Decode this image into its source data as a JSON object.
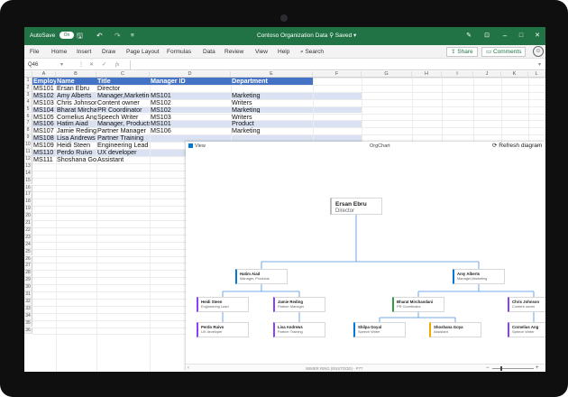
{
  "titlebar": {
    "autosave_label": "AutoSave",
    "autosave_state": "On",
    "doc_title": "Contoso Organization Data",
    "saved_state": "Saved",
    "minimize": "–",
    "restore": "□",
    "close": "✕"
  },
  "menu": {
    "items": [
      "File",
      "Home",
      "Insert",
      "Draw",
      "Page Layout",
      "Formulas",
      "Data",
      "Review",
      "View",
      "Help"
    ],
    "search_label": "Search",
    "share_label": "Share",
    "comments_label": "Comments"
  },
  "formula_bar": {
    "name_box": "Q46",
    "fx_label": "fx",
    "value": ""
  },
  "columns": [
    "A",
    "B",
    "C",
    "D",
    "E",
    "F",
    "G",
    "H",
    "I",
    "J",
    "K",
    "L",
    "M"
  ],
  "rows": [
    "1",
    "2",
    "3",
    "4",
    "5",
    "6",
    "7",
    "8",
    "9",
    "10",
    "11",
    "12",
    "13",
    "14",
    "15",
    "16",
    "17",
    "18",
    "19",
    "20",
    "21",
    "22",
    "23",
    "24",
    "25",
    "26",
    "27",
    "28",
    "29",
    "30",
    "31",
    "32",
    "33",
    "34",
    "35",
    "36"
  ],
  "table": {
    "headers": [
      "Employee ID",
      "Name",
      "Title",
      "Manager ID",
      "Department"
    ],
    "rows": [
      [
        "MS101",
        "Ersan Ebru",
        "Director",
        "",
        ""
      ],
      [
        "MS102",
        "Amy Alberts",
        "Manager,Marketing",
        "MS101",
        "Marketing"
      ],
      [
        "MS103",
        "Chris Johnson",
        "Content owner",
        "MS102",
        "Writers"
      ],
      [
        "MS104",
        "Bharat Mirchandani",
        "PR Coordinator",
        "MS102",
        "Marketing"
      ],
      [
        "MS105",
        "Cornelius Ang",
        "Speech Writer",
        "MS103",
        "Writers"
      ],
      [
        "MS106",
        "Hatim Aiad",
        "Manager, Products",
        "MS101",
        "Product"
      ],
      [
        "MS107",
        "Jamie Reding",
        "Partner Manager",
        "MS106",
        "Marketing"
      ],
      [
        "MS108",
        "Lisa Andrews",
        "Partner Training",
        "",
        ""
      ],
      [
        "MS109",
        "Heidi Steen",
        "Engineering Lead",
        "",
        ""
      ],
      [
        "MS110",
        "Perdo Ruivo",
        "UX developer",
        "",
        ""
      ],
      [
        "MS111",
        "Shoshana Goya",
        "Assistant",
        "",
        ""
      ]
    ]
  },
  "orgpane": {
    "view_label": "View",
    "title": "OrgChart",
    "refresh_label": "Refresh diagram",
    "more_label": "···",
    "footer_note": "WIMER RING (ENSTOOD) - P77",
    "zoom_minus": "−",
    "zoom_plus": "+",
    "zoom_level": "73%",
    "zoom_fraction": 0.2
  },
  "org": {
    "root": {
      "name": "Ersan Ebru",
      "role": "Director"
    },
    "managers": [
      {
        "name": "Hatim Aiad",
        "role": "Manager, Products"
      },
      {
        "name": "Amy Alberts",
        "role": "Manager,Marketing"
      }
    ],
    "level3": [
      {
        "name": "Heidi Steen",
        "role": "Engineering Lead"
      },
      {
        "name": "Jamie Reding",
        "role": "Partner Manager"
      },
      {
        "name": "Bharat Mirchandani",
        "role": "PR Coordinator"
      },
      {
        "name": "Chris Johnson",
        "role": "Content owner"
      }
    ],
    "level4": [
      {
        "name": "Perdo Ruivo",
        "role": "UX developer"
      },
      {
        "name": "Lisa Andrews",
        "role": "Partner Training"
      },
      {
        "name": "Shilpa Goyal",
        "role": "Speech Writer"
      },
      {
        "name": "Shoshana Goya",
        "role": "Assistant"
      },
      {
        "name": "Cornelius Ang",
        "role": "Speech Writer"
      }
    ]
  },
  "colors": {
    "excel_green": "#217346",
    "header_blue": "#4472c4",
    "band_blue": "#d9e1f2",
    "connector": "#4a90e2",
    "accent_green": "#2ea043",
    "accent_yellow": "#f2a900",
    "accent_purple": "#8a3ffc",
    "accent_blue": "#0078d4"
  },
  "icons": [
    "save-icon",
    "undo-icon",
    "redo-icon",
    "search-icon",
    "share-icon",
    "comment-icon",
    "smiley-icon",
    "refresh-icon",
    "view-icon",
    "pen-icon"
  ]
}
